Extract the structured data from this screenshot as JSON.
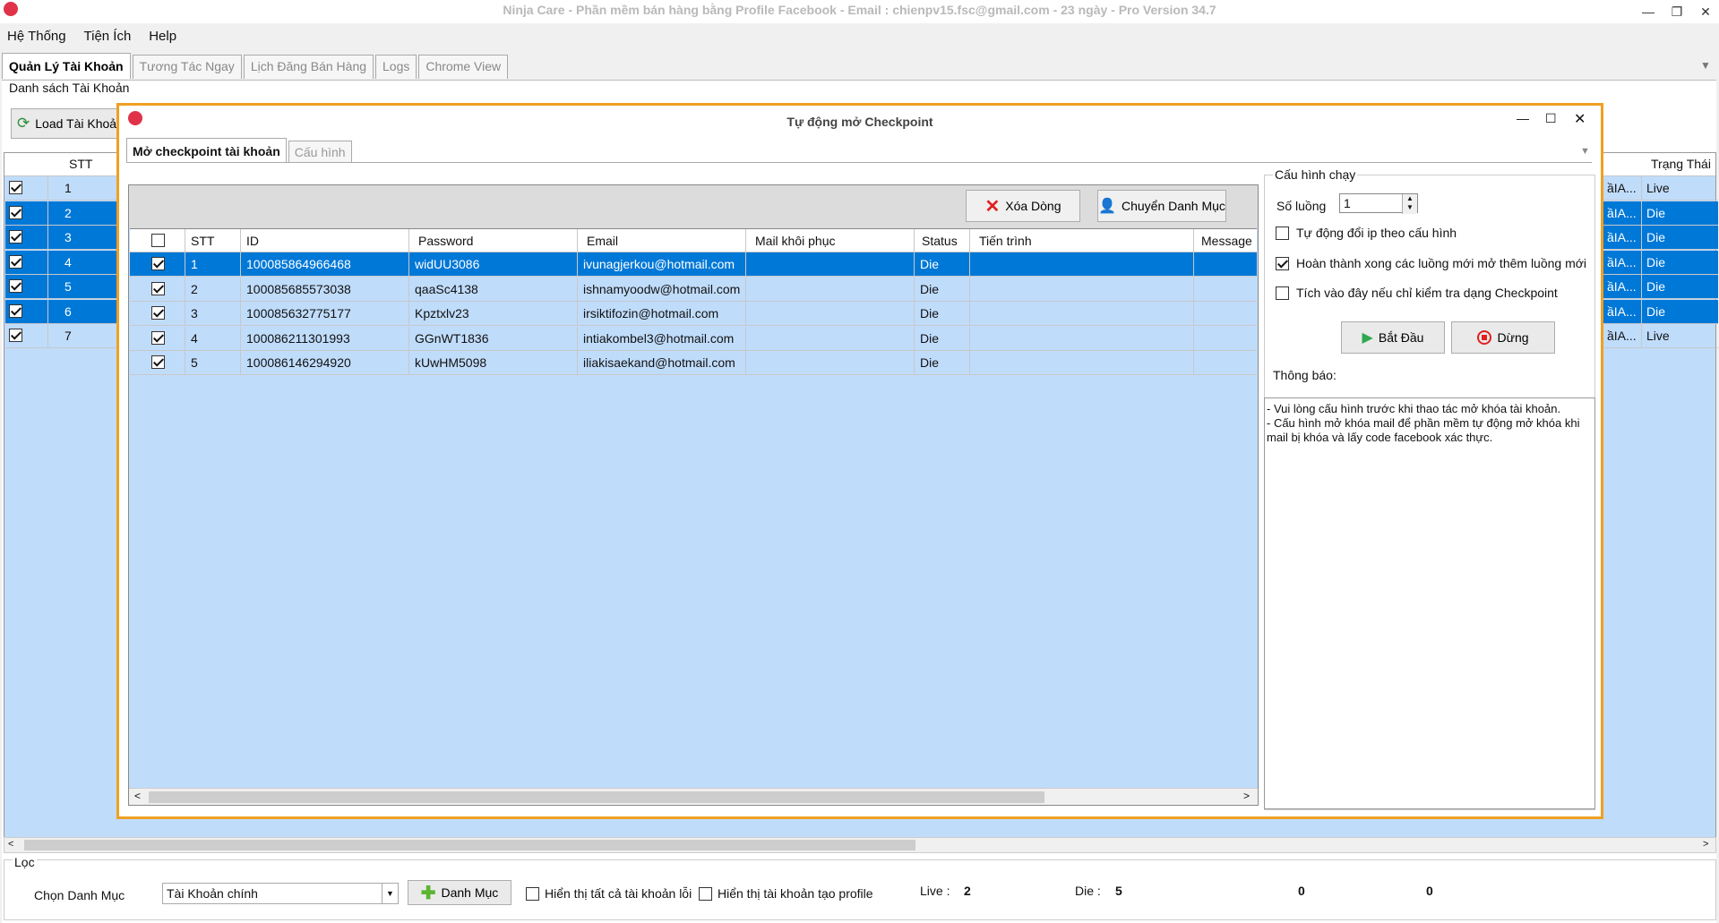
{
  "window": {
    "title": "Ninja Care - Phần mềm bán hàng bằng Profile Facebook - Email : chienpv15.fsc@gmail.com - 23 ngày - Pro Version 34.7",
    "minimize": "—",
    "restore": "❐",
    "close": "✕"
  },
  "menu": [
    "Hệ Thống",
    "Tiện Ích",
    "Help"
  ],
  "main_tabs": [
    "Quản Lý Tài Khoản",
    "Tương Tác Ngay",
    "Lịch Đăng Bán Hàng",
    "Logs",
    "Chrome View"
  ],
  "main_tab_arrow": "▼",
  "account_list": {
    "label": "Danh sách Tài Khoản",
    "load_button": "Load Tài Khoả",
    "headers": {
      "stt": "STT",
      "status": "Trạng Thái"
    },
    "rows": [
      {
        "checked": true,
        "stt": "1",
        "mid": "ầIA...",
        "status": "Live",
        "selected": false
      },
      {
        "checked": true,
        "stt": "2",
        "mid": "ầIA...",
        "status": "Die",
        "selected": true
      },
      {
        "checked": true,
        "stt": "3",
        "mid": "ầIA...",
        "status": "Die",
        "selected": true
      },
      {
        "checked": true,
        "stt": "4",
        "mid": "ầIA...",
        "status": "Die",
        "selected": true
      },
      {
        "checked": true,
        "stt": "5",
        "mid": "ầIA...",
        "status": "Die",
        "selected": true
      },
      {
        "checked": true,
        "stt": "6",
        "mid": "ầIA...",
        "status": "Die",
        "selected": true
      },
      {
        "checked": true,
        "stt": "7",
        "mid": "ầIA...",
        "status": "Live",
        "selected": false
      }
    ]
  },
  "modal": {
    "title": "Tự động mở Checkpoint",
    "tabs": [
      "Mở checkpoint tài khoản",
      "Cấu hình"
    ],
    "tab_arrow": "▼",
    "delete_button": "Xóa Dòng",
    "move_button": "Chuyển Danh Mục",
    "table": {
      "headers": [
        "STT",
        "ID",
        "Password",
        "Email",
        "Mail khôi phục",
        "Status",
        "Tiến trình",
        "Message"
      ],
      "rows": [
        {
          "checked": true,
          "stt": "1",
          "id": "100085864966468",
          "password": "widUU3086",
          "email": "ivunagjerkou@hotmail.com",
          "recovery": "",
          "status": "Die",
          "progress": "",
          "message": "",
          "selected": true
        },
        {
          "checked": true,
          "stt": "2",
          "id": "100085685573038",
          "password": "qaaSc4138",
          "email": "ishnamyoodw@hotmail.com",
          "recovery": "",
          "status": "Die",
          "progress": "",
          "message": "",
          "selected": false
        },
        {
          "checked": true,
          "stt": "3",
          "id": "100085632775177",
          "password": "Kpztxlv23",
          "email": "irsiktifozin@hotmail.com",
          "recovery": "",
          "status": "Die",
          "progress": "",
          "message": "",
          "selected": false
        },
        {
          "checked": true,
          "stt": "4",
          "id": "100086211301993",
          "password": "GGnWT1836",
          "email": "intiakombel3@hotmail.com",
          "recovery": "",
          "status": "Die",
          "progress": "",
          "message": "",
          "selected": false
        },
        {
          "checked": true,
          "stt": "5",
          "id": "100086146294920",
          "password": "kUwHM5098",
          "email": "iliakisaekand@hotmail.com",
          "recovery": "",
          "status": "Die",
          "progress": "",
          "message": "",
          "selected": false
        }
      ]
    },
    "config": {
      "group_label": "Cấu hình chạy",
      "threads_label": "Số luồng",
      "threads_value": "1",
      "option_change_ip": "Tự động đổi ip theo cấu hình",
      "option_change_ip_checked": false,
      "option_finish_threads": "Hoàn thành xong các luồng mới mở thêm luồng mới",
      "option_finish_threads_checked": true,
      "option_check_only": "Tích vào đây nếu chỉ kiểm tra dạng Checkpoint",
      "option_check_only_checked": false,
      "start_button": "Bắt Đầu",
      "stop_button": "Dừng",
      "notice_label": "Thông báo:",
      "notice_text": "- Vui lòng cấu hình trước khi thao tác mở khóa tài khoản.\n- Cấu hình mở khóa mail để phần mềm tự động mở khóa khi mail bị khóa và lấy code facebook xác thực."
    }
  },
  "filter": {
    "label": "Lọc",
    "category_label": "Chọn Danh Mục",
    "category_value": "Tài Khoản chính",
    "add_category_button": "Danh Mục",
    "show_error_accounts": "Hiển thị tất cả tài khoản lỗi",
    "show_profile_accounts": "Hiển thị tài khoản tạo profile",
    "live_label": "Live :",
    "live_count": "2",
    "die_label": "Die :",
    "die_count": "5",
    "count3": "0",
    "count4": "0"
  },
  "colors": {
    "selection": "#0078d7",
    "grid_bg": "#c0dcfb",
    "modal_border": "#f0a020"
  }
}
